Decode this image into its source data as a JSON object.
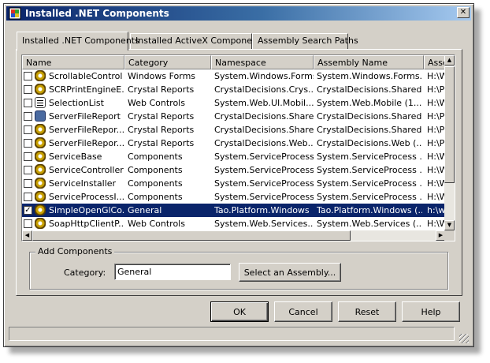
{
  "window": {
    "title": "Installed .NET Components",
    "close_glyph": "✕"
  },
  "tabs": [
    {
      "label": "Installed .NET Components",
      "active": true
    },
    {
      "label": "Installed ActiveX Components",
      "active": false
    },
    {
      "label": "Assembly Search Paths",
      "active": false
    }
  ],
  "columns": [
    "Name",
    "Category",
    "Namespace",
    "Assembly Name",
    "Asse"
  ],
  "rows": [
    {
      "name": "ScrollableControl",
      "category": "Windows Forms",
      "namespace": "System.Windows.Forms",
      "assembly": "System.Windows.Forms...",
      "path": "H:\\W",
      "checked": false,
      "icon": "gear-icon",
      "selected": false
    },
    {
      "name": "SCRPrintEngineE...",
      "category": "Crystal Reports",
      "namespace": "CrystalDecisions.Crys...",
      "assembly": "CrystalDecisions.Shared...",
      "path": "H:\\Pr",
      "checked": false,
      "icon": "gear-icon",
      "selected": false
    },
    {
      "name": "SelectionList",
      "category": "Web Controls",
      "namespace": "System.Web.UI.Mobil...",
      "assembly": "System.Web.Mobile (1....",
      "path": "H:\\W",
      "checked": false,
      "icon": "form-icon",
      "selected": false
    },
    {
      "name": "ServerFileReport",
      "category": "Crystal Reports",
      "namespace": "CrystalDecisions.Shared",
      "assembly": "CrystalDecisions.Shared...",
      "path": "H:\\Pr",
      "checked": false,
      "icon": "report-icon",
      "selected": false
    },
    {
      "name": "ServerFileRepor...",
      "category": "Crystal Reports",
      "namespace": "CrystalDecisions.Shared",
      "assembly": "CrystalDecisions.Shared...",
      "path": "H:\\Pr",
      "checked": false,
      "icon": "gear-icon",
      "selected": false
    },
    {
      "name": "ServerFileRepor...",
      "category": "Crystal Reports",
      "namespace": "CrystalDecisions.Web...",
      "assembly": "CrystalDecisions.Web (...",
      "path": "H:\\Pr",
      "checked": false,
      "icon": "gear-icon",
      "selected": false
    },
    {
      "name": "ServiceBase",
      "category": "Components",
      "namespace": "System.ServiceProcess",
      "assembly": "System.ServiceProcess ...",
      "path": "H:\\W",
      "checked": false,
      "icon": "gear-icon",
      "selected": false
    },
    {
      "name": "ServiceController",
      "category": "Components",
      "namespace": "System.ServiceProcess",
      "assembly": "System.ServiceProcess ...",
      "path": "H:\\W",
      "checked": false,
      "icon": "gear-icon",
      "selected": false
    },
    {
      "name": "ServiceInstaller",
      "category": "Components",
      "namespace": "System.ServiceProcess",
      "assembly": "System.ServiceProcess ...",
      "path": "H:\\W",
      "checked": false,
      "icon": "gear-icon",
      "selected": false
    },
    {
      "name": "ServiceProcessI...",
      "category": "Components",
      "namespace": "System.ServiceProcess",
      "assembly": "System.ServiceProcess ...",
      "path": "H:\\W",
      "checked": false,
      "icon": "gear-icon",
      "selected": false
    },
    {
      "name": "SimpleOpenGlCo...",
      "category": "General",
      "namespace": "Tao.Platform.Windows",
      "assembly": "Tao.Platform.Windows (...",
      "path": "h:\\wi",
      "checked": true,
      "icon": "gear-icon",
      "selected": true
    },
    {
      "name": "SoapHttpClientP...",
      "category": "Web Controls",
      "namespace": "System.Web.Services...",
      "assembly": "System.Web.Services (...",
      "path": "H:\\W",
      "checked": false,
      "icon": "gear-icon",
      "selected": false
    }
  ],
  "add_components": {
    "group_label": "Add Components",
    "category_label": "Category:",
    "category_value": "General",
    "select_assembly_label": "Select an Assembly..."
  },
  "buttons": {
    "ok": "OK",
    "cancel": "Cancel",
    "reset": "Reset",
    "help": "Help"
  },
  "scroll": {
    "up": "▲",
    "down": "▼",
    "left": "◀",
    "right": "▶"
  },
  "check_glyph": "✓"
}
